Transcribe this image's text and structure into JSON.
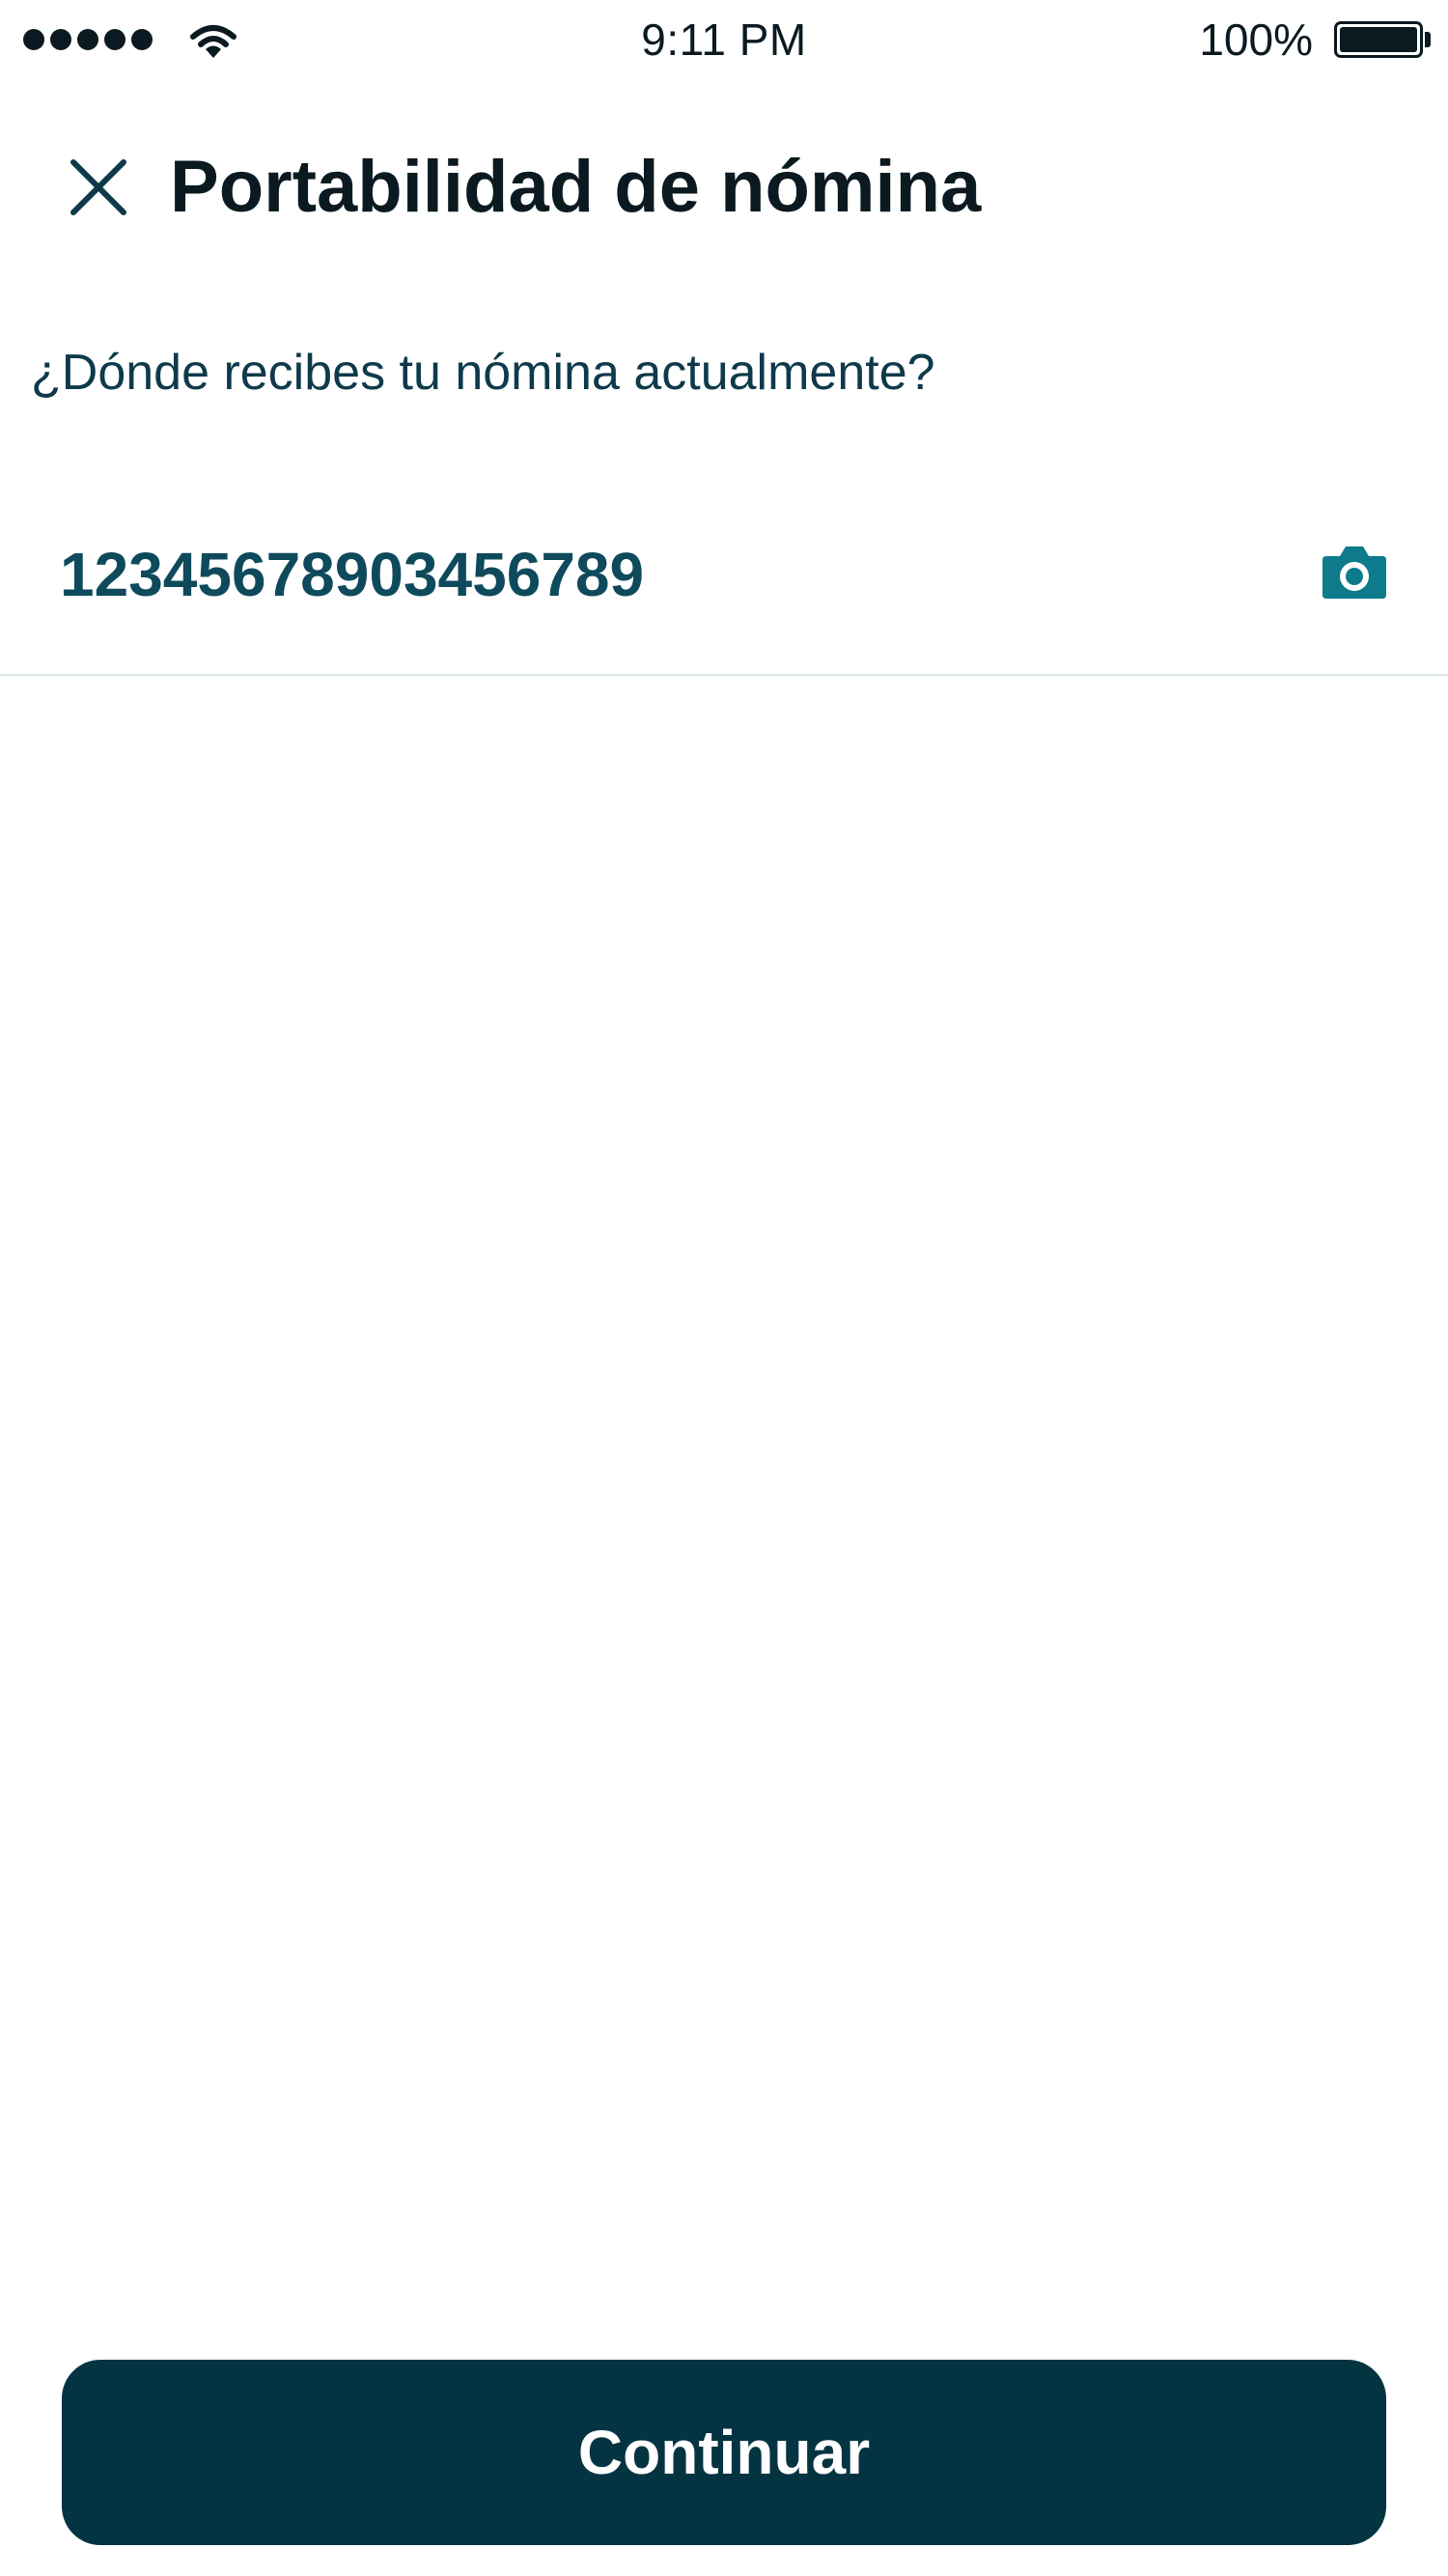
{
  "status_bar": {
    "time": "9:11 PM",
    "battery_percent": "100%",
    "signal_bars": 5,
    "battery_level": 1.0
  },
  "header": {
    "title": "Portabilidad de nómina",
    "close_icon": "close-icon"
  },
  "question": "¿Dónde recibes tu nómina actualmente?",
  "account_input": {
    "value": "12345678903456789",
    "trailing_icon": "camera-icon"
  },
  "continue_button": {
    "label": "Continuar"
  },
  "colors": {
    "primary": "#043442",
    "accent": "#0e7a8c",
    "input_text": "#0e4a5c",
    "divider": "#d7e6ea"
  }
}
